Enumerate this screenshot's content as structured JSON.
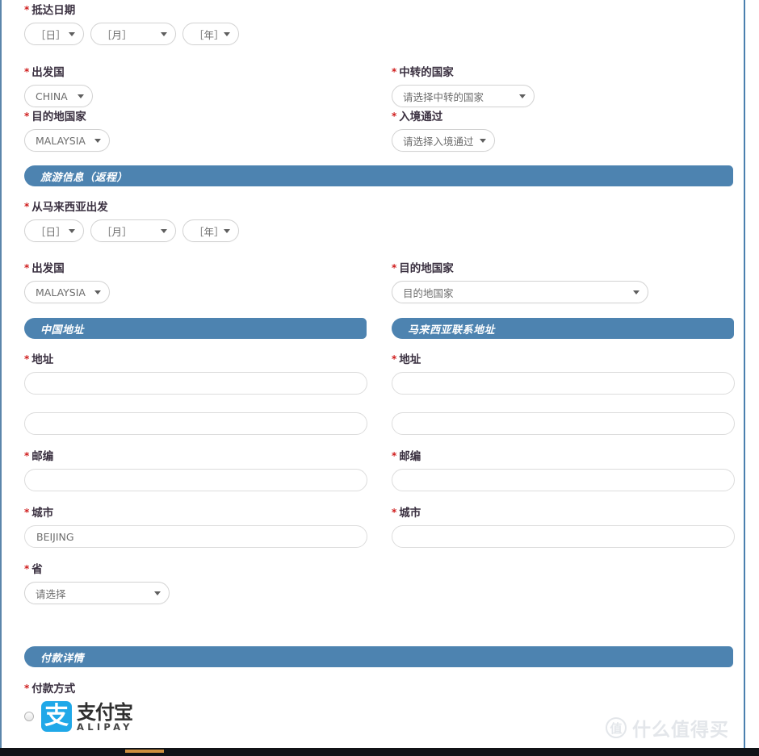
{
  "form": {
    "required_marker": "*",
    "arrival": {
      "label": "抵达日期",
      "day": "［日］",
      "month": "［月］",
      "year": "［年］"
    },
    "departure_country": {
      "label": "出发国",
      "value": "CHINA"
    },
    "destination_country": {
      "label": "目的地国家",
      "value": "MALAYSIA"
    },
    "transit_country": {
      "label": "中转的国家",
      "value": "请选择中转的国家"
    },
    "entry_via": {
      "label": "入境通过",
      "value": "请选择入境通过"
    },
    "return_section": {
      "title": "旅游信息（返程）",
      "depart_from_malaysia": {
        "label": "从马来西亚出发",
        "day": "［日］",
        "month": "［月］",
        "year": "［年］"
      },
      "departure_country": {
        "label": "出发国",
        "value": "MALAYSIA"
      },
      "destination_country": {
        "label": "目的地国家",
        "value": "目的地国家"
      }
    },
    "china_address": {
      "title": "中国地址",
      "address_label": "地址",
      "address_line1": "",
      "address_line2": "",
      "postcode_label": "邮编",
      "postcode": "",
      "city_label": "城市",
      "city": "BEIJING",
      "province_label": "省",
      "province": "请选择"
    },
    "malaysia_address": {
      "title": "马来西亚联系地址",
      "address_label": "地址",
      "address_line1": "",
      "address_line2": "",
      "postcode_label": "邮编",
      "postcode": "",
      "city_label": "城市",
      "city": ""
    },
    "payment": {
      "title": "付款详情",
      "method_label": "付款方式",
      "alipay": {
        "mark_glyph": "支",
        "name_cn": "支付宝",
        "name_en": "ALIPAY"
      }
    }
  },
  "watermark": {
    "badge": "值",
    "text": "什么值得买"
  },
  "colors": {
    "section_bar": "#4d83b0",
    "required": "#cf1b1b",
    "alipay_blue": "#20a8e8",
    "frame_border": "#4a7fae",
    "bottom_bar": "#111317",
    "bottom_accent": "#cf8f3e"
  }
}
